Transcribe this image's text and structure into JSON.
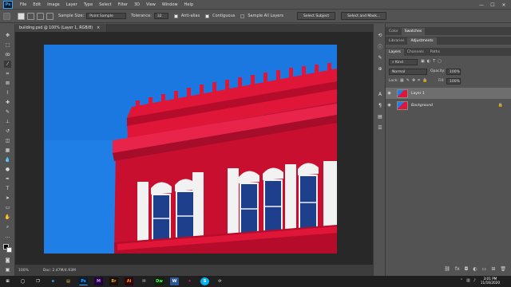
{
  "menu": {
    "logo": "Ps",
    "items": [
      "File",
      "Edit",
      "Image",
      "Layer",
      "Type",
      "Select",
      "Filter",
      "3D",
      "View",
      "Window",
      "Help"
    ]
  },
  "window_controls": {
    "minimize": "—",
    "maximize": "☐",
    "close": "✕"
  },
  "options": {
    "sample_size_label": "Sample Size:",
    "sample_size_value": "Point Sample",
    "tolerance_label": "Tolerance:",
    "tolerance_value": "32",
    "anti_alias": "Anti-alias",
    "contiguous": "Contiguous",
    "sample_all_layers": "Sample All Layers",
    "select_subject": "Select Subject",
    "select_and_mask": "Select and Mask..."
  },
  "document": {
    "tab_title": "building.psd @ 100% (Layer 1, RGB/8)",
    "tab_close": "×"
  },
  "status": {
    "zoom": "100%",
    "doc_size": "Doc: 2.47M/4.93M"
  },
  "panels": {
    "top_tabs": [
      "Color",
      "Swatches"
    ],
    "mid_tabs": [
      "Libraries",
      "Adjustments"
    ],
    "layer_tabs": [
      "Layers",
      "Channels",
      "Paths"
    ],
    "filter_kind": "Kind",
    "blend_mode": "Normal",
    "opacity_label": "Opacity:",
    "opacity_value": "100%",
    "lock_label": "Lock:",
    "fill_label": "Fill:",
    "fill_value": "100%",
    "layers": [
      {
        "name": "Layer 1",
        "selected": true
      },
      {
        "name": "Background",
        "selected": false
      }
    ]
  },
  "taskbar": {
    "apps": [
      "⊞",
      "◯",
      "❐",
      "e",
      "▤",
      "Ps",
      "M",
      "Br",
      "Ai",
      "✉",
      "Dw",
      "W",
      "✦",
      "S",
      "⟳"
    ],
    "time": "3:01 PM",
    "date": "11/16/2020"
  },
  "colors": {
    "accent": "#31a8ff",
    "sky": "#1f7fe6",
    "building_red": "#e01639",
    "building_dark": "#a60d2a",
    "trim_white": "#f2f2f2"
  }
}
